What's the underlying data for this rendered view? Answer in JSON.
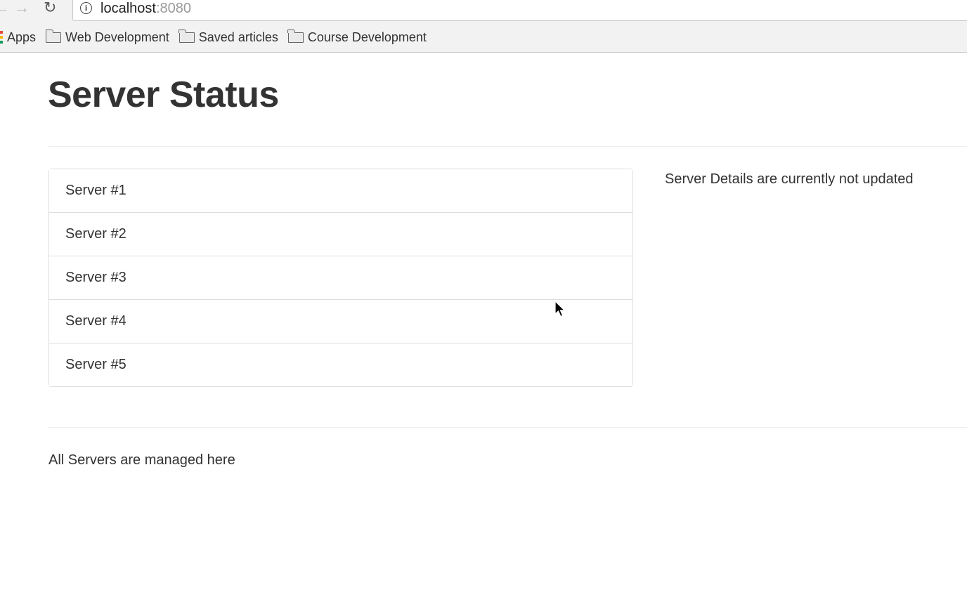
{
  "browser": {
    "url_host": "localhost",
    "url_port": ":8080",
    "bookmarks": [
      {
        "label": "Apps",
        "icon": "apps-grid-icon"
      },
      {
        "label": "Web Development",
        "icon": "folder-icon"
      },
      {
        "label": "Saved articles",
        "icon": "folder-icon"
      },
      {
        "label": "Course Development",
        "icon": "folder-icon"
      }
    ]
  },
  "page": {
    "title": "Server Status",
    "servers": [
      "Server #1",
      "Server #2",
      "Server #3",
      "Server #4",
      "Server #5"
    ],
    "details_text": "Server Details are currently not updated",
    "footer_text": "All Servers are managed here"
  },
  "colors": {
    "text": "#333333",
    "border": "#dddddd",
    "chrome_bg": "#f2f2f2"
  }
}
